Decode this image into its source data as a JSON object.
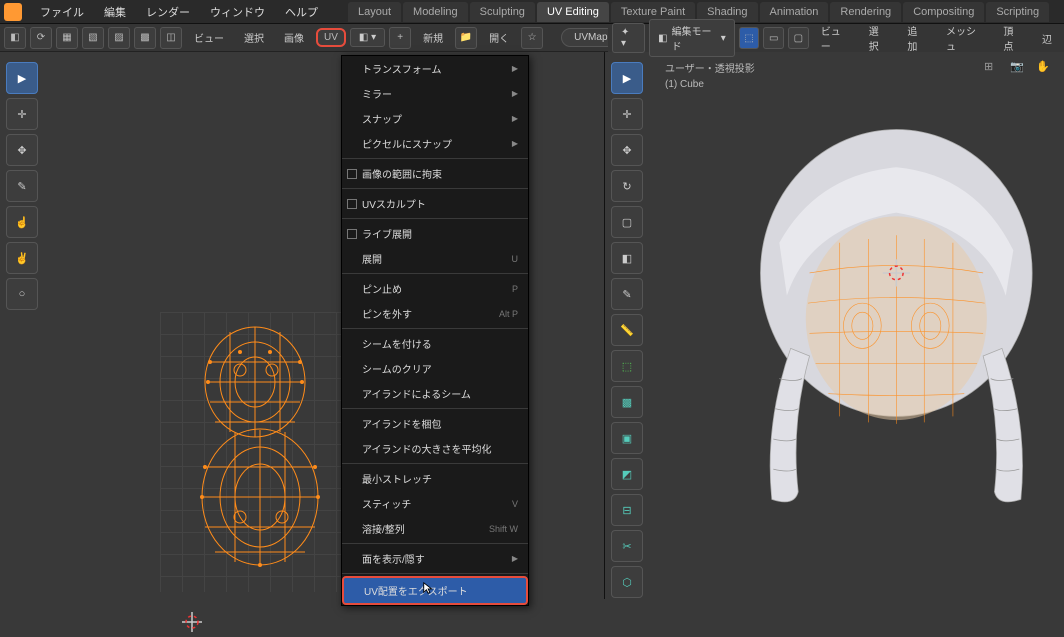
{
  "topbar": {
    "menus": [
      "ファイル",
      "編集",
      "レンダー",
      "ウィンドウ",
      "ヘルプ"
    ],
    "tabs": [
      "Layout",
      "Modeling",
      "Sculpting",
      "UV Editing",
      "Texture Paint",
      "Shading",
      "Animation",
      "Rendering",
      "Compositing",
      "Scripting"
    ],
    "active_tab": "UV Editing"
  },
  "toolbar_left": {
    "view": "ビュー",
    "select": "選択",
    "image": "画像",
    "uv": "UV",
    "new": "新規",
    "open": "開く",
    "uvmap": "UVMap"
  },
  "toolbar_right": {
    "mode": "編集モード",
    "view": "ビュー",
    "select": "選択",
    "add": "追加",
    "mesh": "メッシュ",
    "vertex": "頂点",
    "edge": "辺"
  },
  "dropdown": {
    "items": [
      {
        "label": "トランスフォーム",
        "submenu": true
      },
      {
        "label": "ミラー",
        "submenu": true
      },
      {
        "label": "スナップ",
        "submenu": true
      },
      {
        "label": "ピクセルにスナップ",
        "submenu": true
      },
      {
        "label": "画像の範囲に拘束",
        "checkbox": true,
        "sep_before": true
      },
      {
        "label": "UVスカルプト",
        "checkbox": true,
        "sep_before": true
      },
      {
        "label": "ライブ展開",
        "checkbox": true,
        "sep_before": true
      },
      {
        "label": "展開",
        "shortcut": "U"
      },
      {
        "label": "ピン止め",
        "shortcut": "P",
        "sep_before": true
      },
      {
        "label": "ピンを外す",
        "shortcut": "Alt P"
      },
      {
        "label": "シームを付ける",
        "sep_before": true
      },
      {
        "label": "シームのクリア"
      },
      {
        "label": "アイランドによるシーム"
      },
      {
        "label": "アイランドを梱包",
        "sep_before": true
      },
      {
        "label": "アイランドの大きさを平均化"
      },
      {
        "label": "最小ストレッチ",
        "sep_before": true
      },
      {
        "label": "スティッチ",
        "shortcut": "V"
      },
      {
        "label": "溶接/整列",
        "shortcut": "Shift W"
      },
      {
        "label": "面を表示/隠す",
        "submenu": true,
        "sep_before": true
      },
      {
        "label": "UV配置をエクスポート",
        "selected": true,
        "sep_before": true
      }
    ]
  },
  "viewport3d": {
    "projection": "ユーザー・透視投影",
    "object": "(1) Cube"
  }
}
